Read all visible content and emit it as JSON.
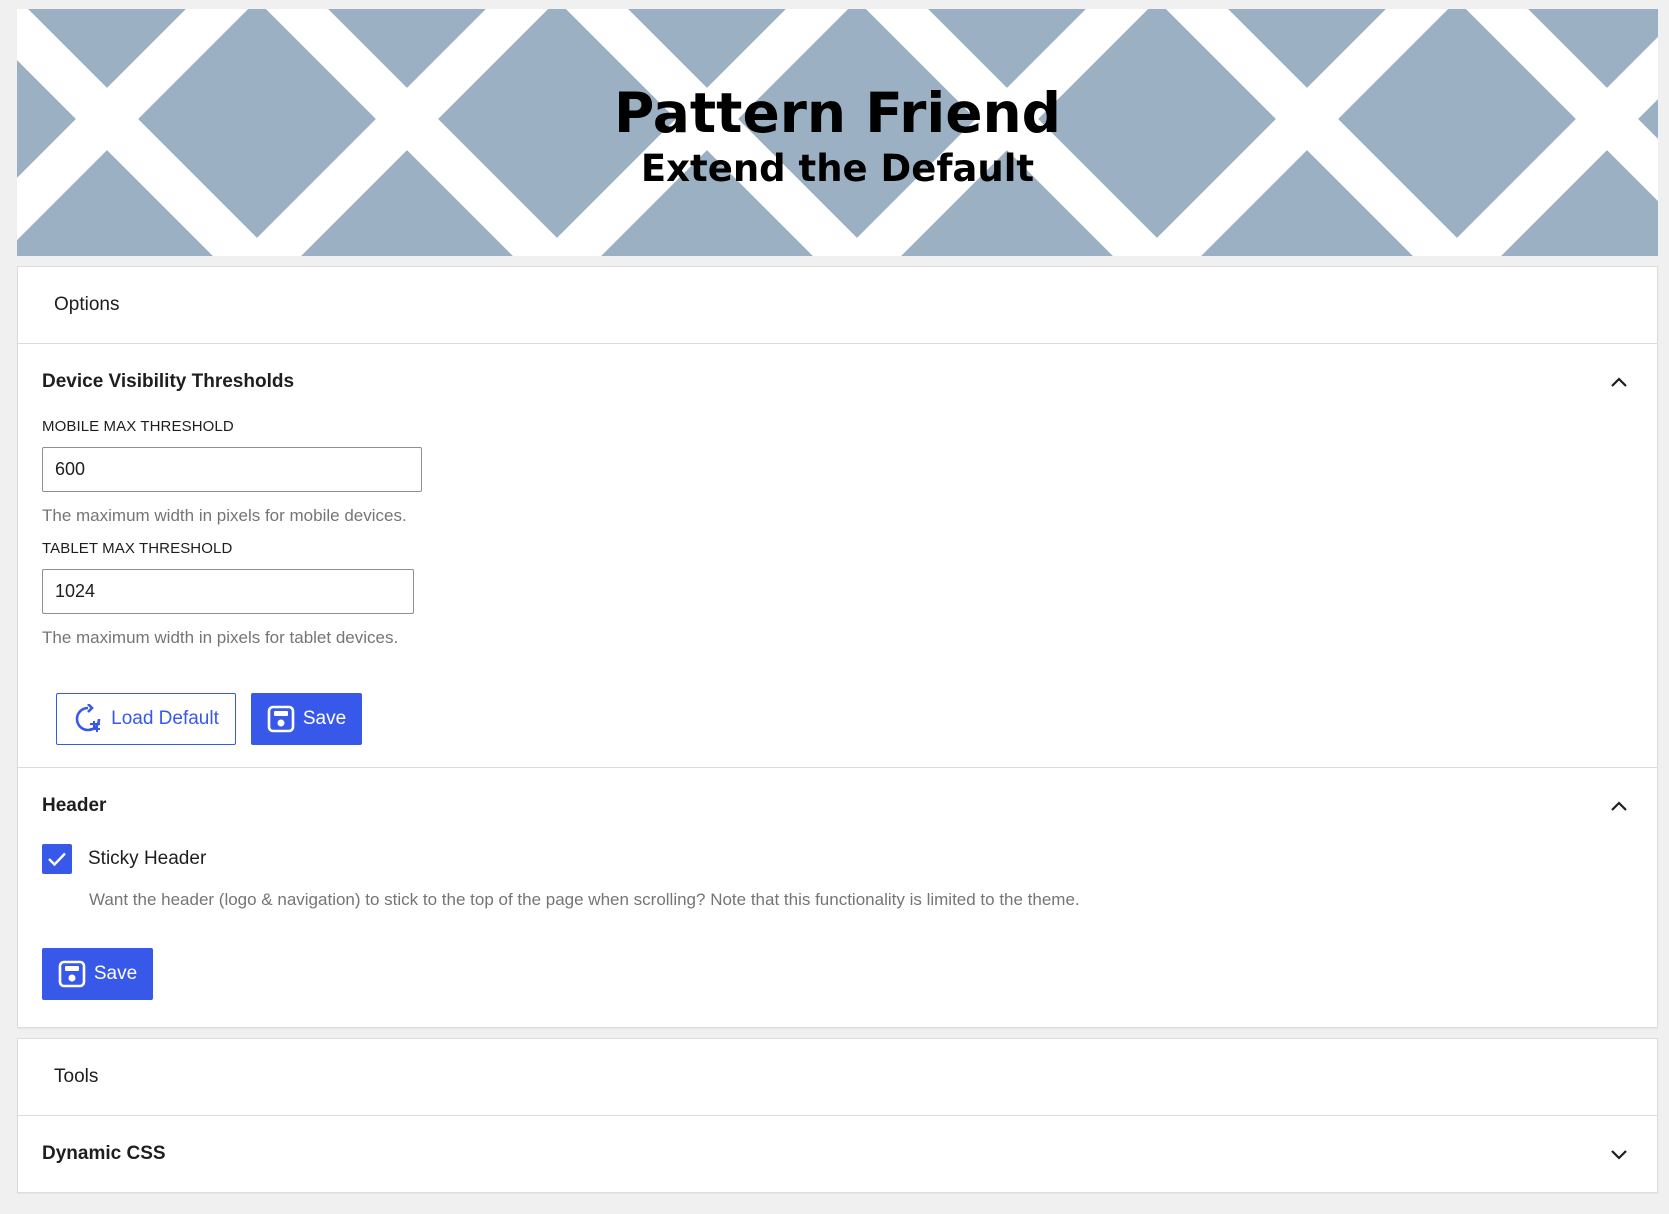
{
  "banner": {
    "title": "Pattern Friend",
    "subtitle": "Extend the Default"
  },
  "options_panel": {
    "header": "Options",
    "device_visibility": {
      "title": "Device Visibility Thresholds",
      "toggle_icon": "chevron-up-icon",
      "mobile": {
        "label": "MOBILE MAX THRESHOLD",
        "value": "600",
        "help": "The maximum width in pixels for mobile devices."
      },
      "tablet": {
        "label": "TABLET MAX THRESHOLD",
        "value": "1024",
        "help": "The maximum width in pixels for tablet devices."
      },
      "load_default_label": "Load Default",
      "save_label": "Save"
    },
    "header_section": {
      "title": "Header",
      "toggle_icon": "chevron-up-icon",
      "sticky_label": "Sticky Header",
      "sticky_checked": true,
      "sticky_help": "Want the header (logo & navigation) to stick to the top of the page when scrolling? Note that this functionality is limited to the theme.",
      "save_label": "Save"
    }
  },
  "tools_panel": {
    "header": "Tools",
    "dynamic_css": {
      "title": "Dynamic CSS",
      "toggle_icon": "chevron-down-icon"
    }
  },
  "colors": {
    "accent": "#3858e9",
    "banner_bg": "#9bb0c2",
    "help_text": "#757575"
  }
}
